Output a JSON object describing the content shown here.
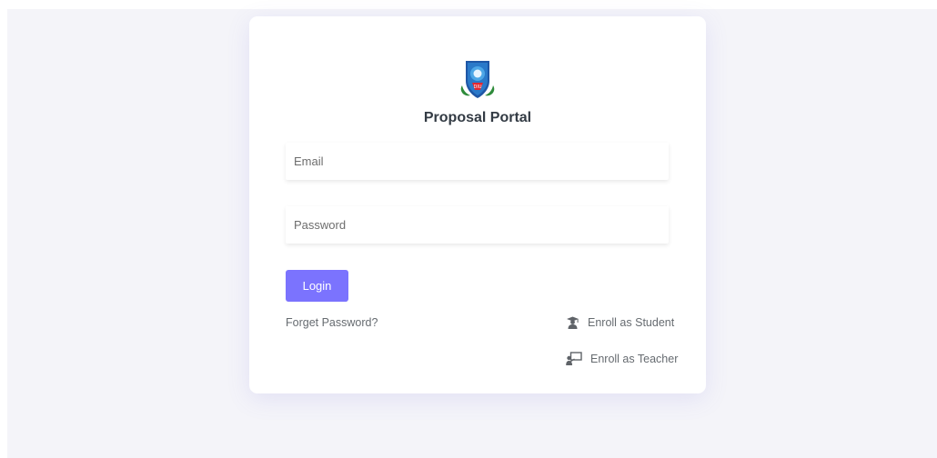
{
  "app": {
    "title": "Proposal Portal"
  },
  "logo": {
    "icon": "diu-shield-logo-icon"
  },
  "form": {
    "email_placeholder": "Email",
    "password_placeholder": "Password",
    "login_label": "Login"
  },
  "links": {
    "forget_password": "Forget Password?",
    "enroll_student": "Enroll as Student",
    "enroll_teacher": "Enroll as Teacher"
  },
  "icons": {
    "enroll_student": "graduate-icon",
    "enroll_teacher": "teacher-board-icon"
  },
  "colors": {
    "accent": "#7b73fe",
    "background": "#f4f4f9",
    "card": "#ffffff",
    "title_text": "#333b44",
    "link_text": "#666b70"
  }
}
